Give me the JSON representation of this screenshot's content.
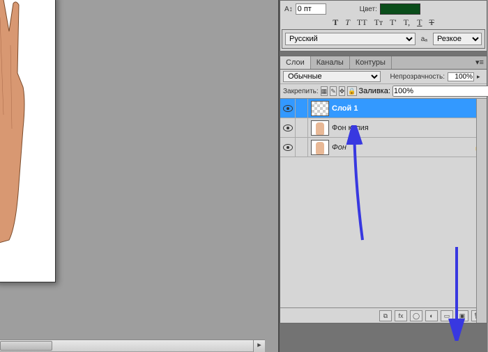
{
  "character_panel": {
    "at_icon": "A↕",
    "leading_value": "0 пт",
    "color_label": "Цвет:",
    "color_value": "#0a4d1a",
    "type_buttons": [
      "T",
      "T",
      "TT",
      "Tт",
      "T'",
      "T,",
      "T",
      "Ŧ"
    ],
    "language_options": [
      "Русский"
    ],
    "language_value": "Русский",
    "aa_label": "aₐ",
    "antialias_options": [
      "Резкое"
    ],
    "antialias_value": "Резкое"
  },
  "layers_panel": {
    "tabs": [
      "Слои",
      "Каналы",
      "Контуры"
    ],
    "active_tab": 0,
    "blend_mode_options": [
      "Обычные"
    ],
    "blend_mode_value": "Обычные",
    "opacity_label": "Непрозрачность:",
    "opacity_value": "100%",
    "lock_label": "Закрепить:",
    "fill_label": "Заливка:",
    "fill_value": "100%",
    "layers": [
      {
        "name": "Слой 1",
        "visible": true,
        "selected": true,
        "thumb": "checker",
        "locked": false
      },
      {
        "name": "Фон копия",
        "visible": true,
        "selected": false,
        "thumb": "hand",
        "locked": false
      },
      {
        "name": "Фон",
        "visible": true,
        "selected": false,
        "thumb": "hand",
        "locked": true,
        "italic": true
      }
    ],
    "bottom_icons": [
      "link",
      "fx",
      "mask",
      "adjust",
      "group",
      "new",
      "trash"
    ]
  }
}
